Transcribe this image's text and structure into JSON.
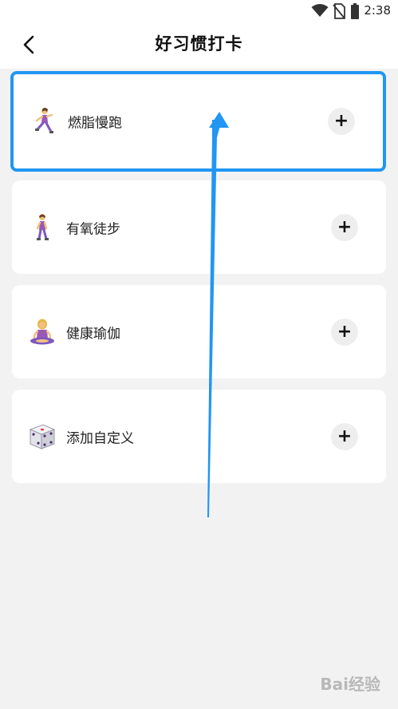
{
  "status_bar": {
    "time": "2:38",
    "icons": [
      "wifi-icon",
      "no-sim-icon",
      "battery-icon"
    ]
  },
  "header": {
    "title": "好习惯打卡",
    "back_icon": "back-chevron-icon"
  },
  "habits": [
    {
      "label": "燃脂慢跑",
      "icon": "running-woman-icon",
      "action": "+"
    },
    {
      "label": "有氧徒步",
      "icon": "walking-woman-icon",
      "action": "+"
    },
    {
      "label": "健康瑜伽",
      "icon": "yoga-woman-icon",
      "action": "+"
    },
    {
      "label": "添加自定义",
      "icon": "dice-icon",
      "action": "+"
    }
  ],
  "watermark": "Bai经验",
  "colors": {
    "highlight": "#2196f3",
    "background": "#f2f2f2",
    "card": "#ffffff"
  }
}
